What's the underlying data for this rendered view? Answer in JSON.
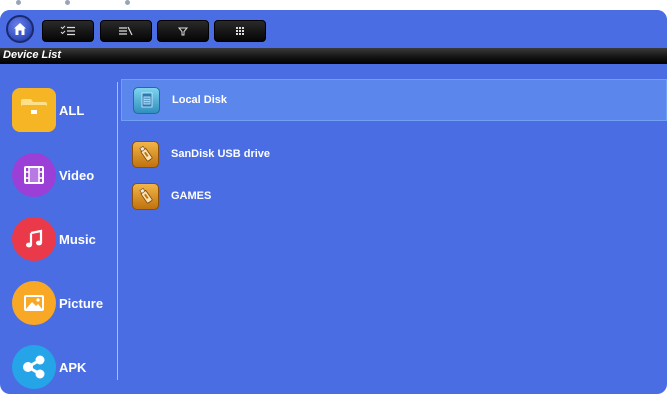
{
  "header": {
    "title": "Device List"
  },
  "toolbar": {
    "buttons": [
      {
        "icon": "home-icon"
      },
      {
        "icon": "checklist-icon"
      },
      {
        "icon": "sort-icon"
      },
      {
        "icon": "filter-icon"
      },
      {
        "icon": "grid-icon"
      }
    ]
  },
  "sidebar": {
    "items": [
      {
        "label": "ALL",
        "icon": "folder-icon",
        "color": "#f6b524"
      },
      {
        "label": "Video",
        "icon": "film-icon",
        "color": "#9b3fd6"
      },
      {
        "label": "Music",
        "icon": "music-note-icon",
        "color": "#ea3a49"
      },
      {
        "label": "Picture",
        "icon": "picture-icon",
        "color": "#f9a826"
      },
      {
        "label": "APK",
        "icon": "share-icon",
        "color": "#25a5e8"
      }
    ]
  },
  "devices": [
    {
      "name": "Local Disk",
      "icon": "sd-card-icon",
      "selected": true
    },
    {
      "name": "SanDisk USB drive",
      "icon": "usb-drive-icon",
      "selected": false
    },
    {
      "name": "GAMES",
      "icon": "usb-drive-icon",
      "selected": false
    }
  ],
  "colors": {
    "background": "#4a6de3",
    "selected_row": "#5b86ec",
    "usb_icon": "#d68a1c",
    "disk_icon": "#4fb6d9"
  }
}
